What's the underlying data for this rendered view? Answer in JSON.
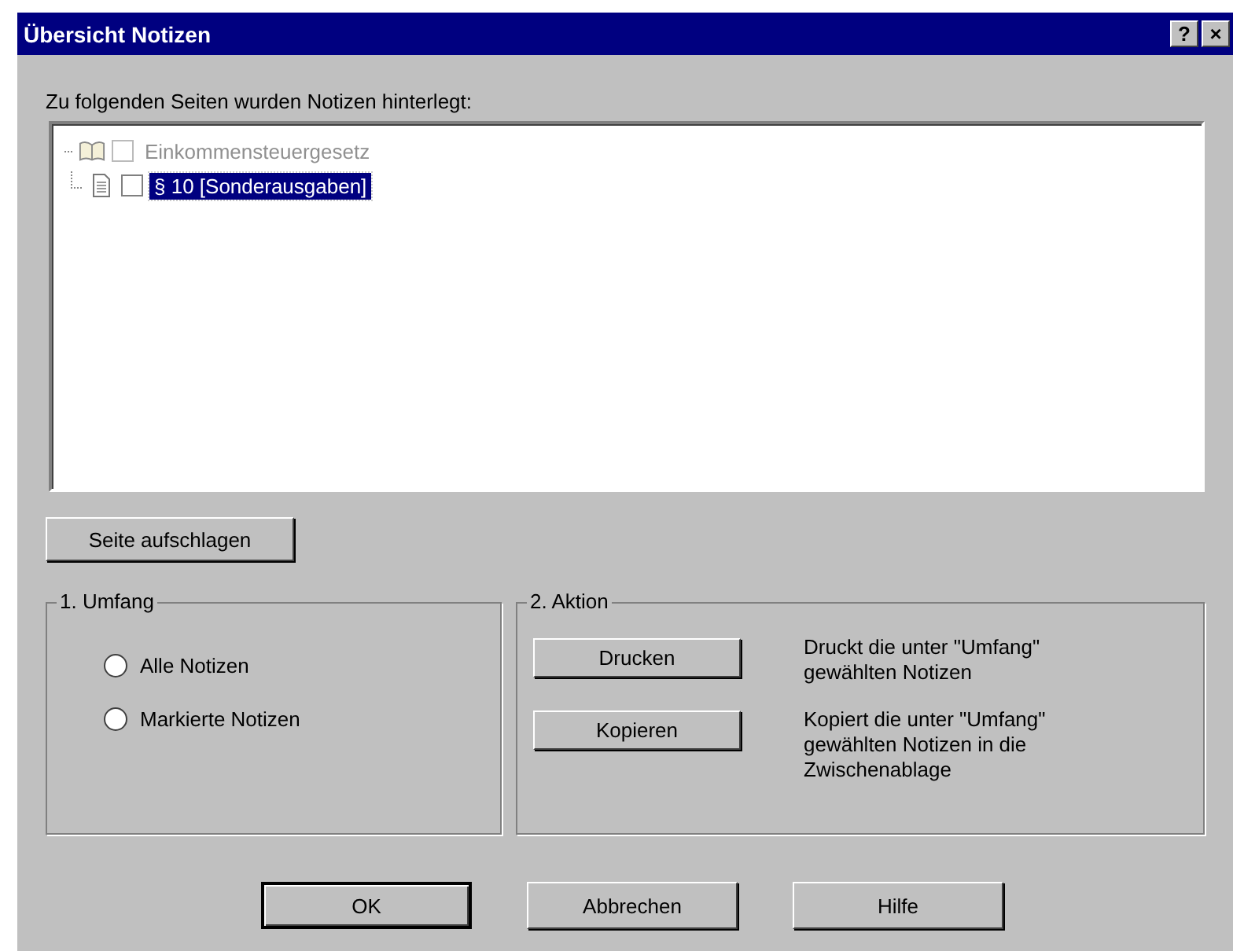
{
  "window": {
    "title": "Übersicht Notizen",
    "title_buttons": [
      "?",
      "×"
    ]
  },
  "tree_label": "Zu folgenden Seiten wurden Notizen hinterlegt:",
  "tree": [
    {
      "label": "Einkommensteuergesetz",
      "checked": false,
      "disabled": true,
      "selected": false,
      "children": [
        {
          "label": "§ 10 [Sonderausgaben]",
          "checked": false,
          "disabled": false,
          "selected": true
        }
      ]
    }
  ],
  "open_button": "Seite aufschlagen",
  "scope": {
    "title": "1. Umfang",
    "options": [
      {
        "label": "Alle Notizen",
        "selected": false
      },
      {
        "label": "Markierte Notizen",
        "selected": false
      }
    ]
  },
  "action": {
    "title": "2. Aktion",
    "rows": [
      {
        "button": "Drucken",
        "description": "Druckt die unter \"Umfang\" gewählten Notizen"
      },
      {
        "button": "Kopieren",
        "description": "Kopiert die unter \"Umfang\" gewählten Notizen in die Zwischenablage"
      }
    ]
  },
  "buttons": [
    {
      "label": "OK",
      "default": true
    },
    {
      "label": "Abbrechen",
      "default": false
    },
    {
      "label": "Hilfe",
      "default": false
    }
  ]
}
